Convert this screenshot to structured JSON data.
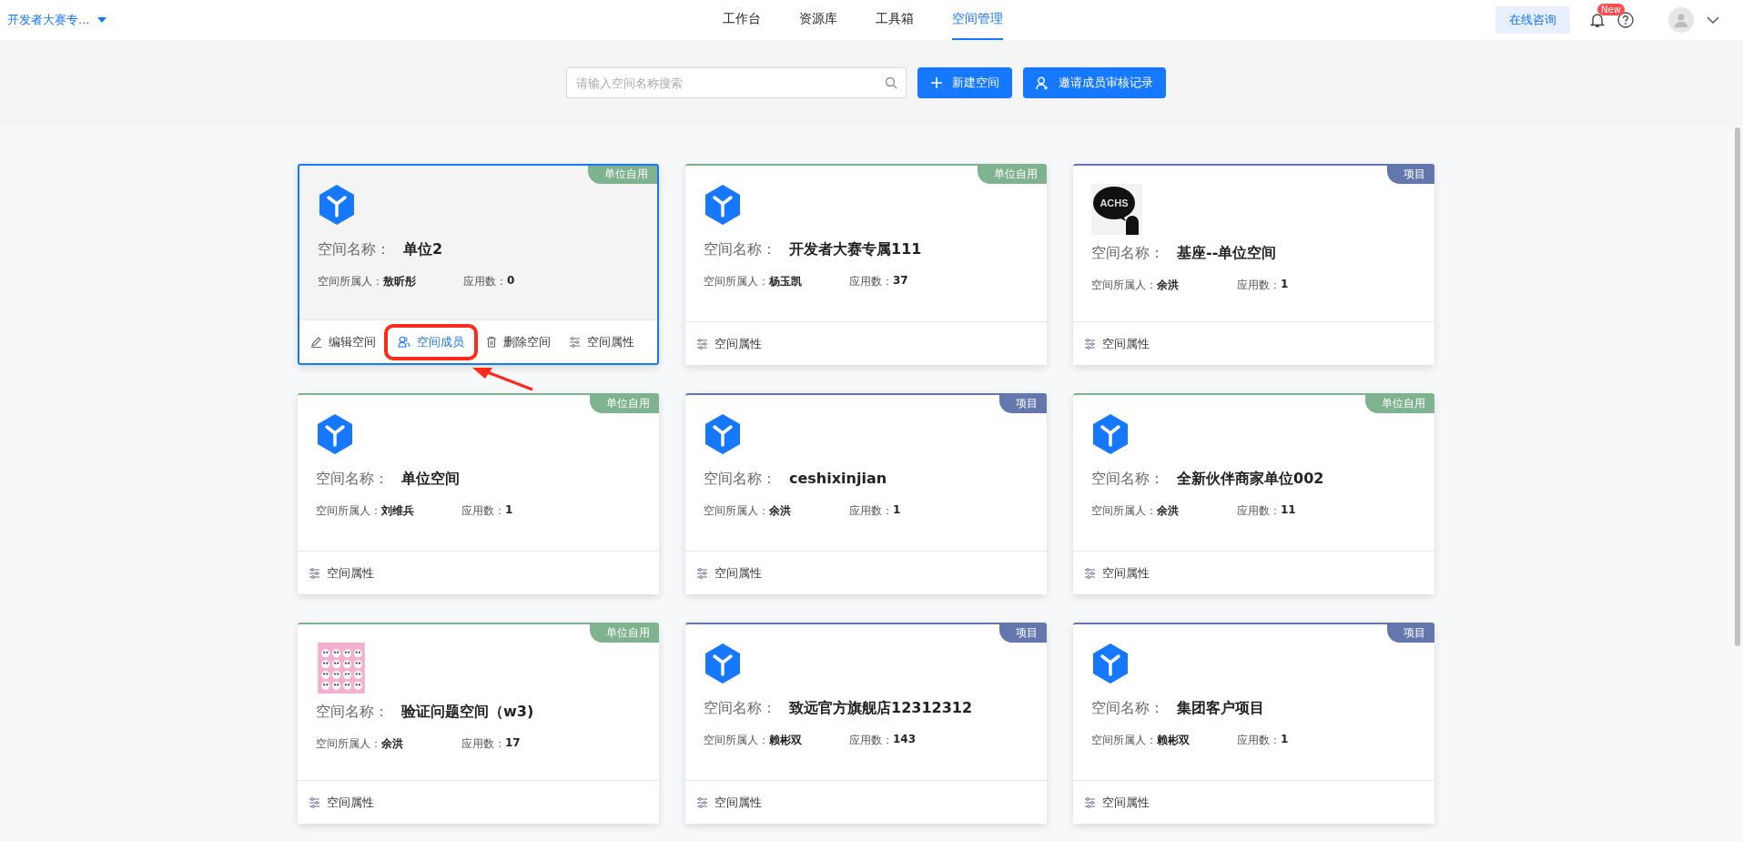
{
  "header": {
    "workspace": "开发者大赛专...",
    "nav": [
      {
        "label": "工作台",
        "selected": false
      },
      {
        "label": "资源库",
        "selected": false
      },
      {
        "label": "工具箱",
        "selected": false
      },
      {
        "label": "空间管理",
        "selected": true
      }
    ],
    "consult": "在线咨询",
    "badge": "New"
  },
  "toolbar": {
    "search": {
      "placeholder": "请输入空间名称搜索"
    },
    "buttons": [
      {
        "kind": "plus",
        "label": "新建空间"
      },
      {
        "kind": "user",
        "label": "邀请成员审核记录"
      }
    ]
  },
  "cards": [
    {
      "tag": "单位自用",
      "color": "#7fb28f",
      "logo": {
        "kind": "cube"
      },
      "name_label": "空间名称：",
      "name": "单位2",
      "owner_label": "空间所属人：",
      "owner": "敖昕彤",
      "apps_label": "应用数：",
      "apps": "0",
      "selected": true,
      "actions": [
        {
          "kind": "edit",
          "label": "编辑空间",
          "highlighted": false
        },
        {
          "kind": "members",
          "label": "空间成员",
          "highlighted": true
        },
        {
          "kind": "delete",
          "label": "删除空间",
          "highlighted": false
        },
        {
          "kind": "props",
          "label": "空间属性",
          "highlighted": false
        }
      ]
    },
    {
      "tag": "单位自用",
      "color": "#7fb28f",
      "logo": {
        "kind": "cube"
      },
      "name_label": "空间名称：",
      "name": "开发者大赛专属111",
      "owner_label": "空间所属人：",
      "owner": "杨玉凯",
      "apps_label": "应用数：",
      "apps": "37",
      "selected": false,
      "actions": [
        {
          "kind": "props",
          "label": "空间属性",
          "highlighted": false
        }
      ]
    },
    {
      "tag": "项目",
      "color": "#6477ad",
      "logo": {
        "kind": "bubble",
        "text": "ACHS"
      },
      "name_label": "空间名称：",
      "name": "基座--单位空间",
      "owner_label": "空间所属人：",
      "owner": "余洪",
      "apps_label": "应用数：",
      "apps": "1",
      "selected": false,
      "actions": [
        {
          "kind": "props",
          "label": "空间属性",
          "highlighted": false
        }
      ]
    },
    {
      "tag": "单位自用",
      "color": "#7fb28f",
      "logo": {
        "kind": "cube"
      },
      "name_label": "空间名称：",
      "name": "单位空间",
      "owner_label": "空间所属人：",
      "owner": "刘维兵",
      "apps_label": "应用数：",
      "apps": "1",
      "selected": false,
      "actions": [
        {
          "kind": "props",
          "label": "空间属性",
          "highlighted": false
        }
      ]
    },
    {
      "tag": "项目",
      "color": "#6477ad",
      "logo": {
        "kind": "cube"
      },
      "name_label": "空间名称：",
      "name": "ceshixinjian",
      "owner_label": "空间所属人：",
      "owner": "余洪",
      "apps_label": "应用数：",
      "apps": "1",
      "selected": false,
      "actions": [
        {
          "kind": "props",
          "label": "空间属性",
          "highlighted": false
        }
      ]
    },
    {
      "tag": "单位自用",
      "color": "#7fb28f",
      "logo": {
        "kind": "cube"
      },
      "name_label": "空间名称：",
      "name": "全新伙伴商家单位002",
      "owner_label": "空间所属人：",
      "owner": "余洪",
      "apps_label": "应用数：",
      "apps": "11",
      "selected": false,
      "actions": [
        {
          "kind": "props",
          "label": "空间属性",
          "highlighted": false
        }
      ]
    },
    {
      "tag": "单位自用",
      "color": "#7fb28f",
      "logo": {
        "kind": "pattern"
      },
      "name_label": "空间名称：",
      "name": "验证问题空间（w3)",
      "owner_label": "空间所属人：",
      "owner": "余洪",
      "apps_label": "应用数：",
      "apps": "17",
      "selected": false,
      "actions": [
        {
          "kind": "props",
          "label": "空间属性",
          "highlighted": false
        }
      ]
    },
    {
      "tag": "项目",
      "color": "#6477ad",
      "logo": {
        "kind": "cube"
      },
      "name_label": "空间名称：",
      "name": "致远官方旗舰店12312312",
      "owner_label": "空间所属人：",
      "owner": "赖彬双",
      "apps_label": "应用数：",
      "apps": "143",
      "selected": false,
      "actions": [
        {
          "kind": "props",
          "label": "空间属性",
          "highlighted": false
        }
      ]
    },
    {
      "tag": "项目",
      "color": "#6477ad",
      "logo": {
        "kind": "cube"
      },
      "name_label": "空间名称：",
      "name": "集团客户项目",
      "owner_label": "空间所属人：",
      "owner": "赖彬双",
      "apps_label": "应用数：",
      "apps": "1",
      "selected": false,
      "actions": [
        {
          "kind": "props",
          "label": "空间属性",
          "highlighted": false
        }
      ]
    }
  ]
}
